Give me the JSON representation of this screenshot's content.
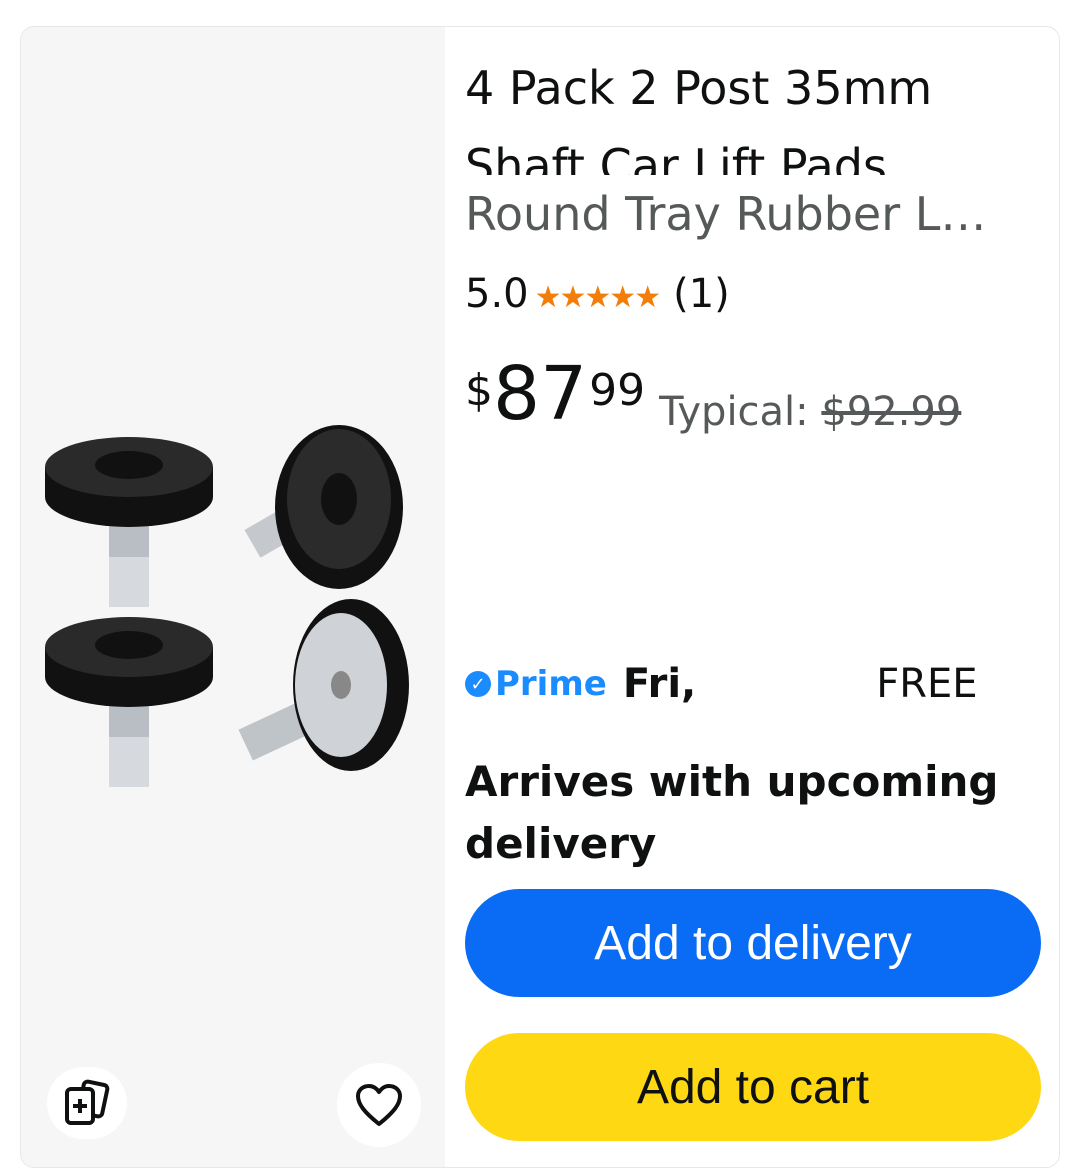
{
  "product": {
    "title_line1": "4 Pack 2 Post 35mm",
    "title_line2": "Shaft Car Lift Pads",
    "subtitle": "Round Tray Rubber L…",
    "rating": "5.0",
    "stars": "★★★★★",
    "review_count": "(1)",
    "price_symbol": "$",
    "price_whole": "87",
    "price_fraction": "99",
    "typical_label": "Typical: ",
    "typical_price": "$92.99"
  },
  "delivery": {
    "prime_label": "Prime",
    "prime_check": "✓",
    "day": "Fri,",
    "free": "FREE",
    "arrival": "Arrives with upcoming delivery"
  },
  "buttons": {
    "add_to_delivery": "Add to delivery",
    "add_to_cart": "Add to cart"
  },
  "colors": {
    "accent_blue": "#0a6cf5",
    "cart_yellow": "#ffd814",
    "star_orange": "#f27d08",
    "prime_blue": "#1a8cff"
  },
  "icons": {
    "compare": "compare-icon",
    "wishlist": "heart-icon"
  }
}
